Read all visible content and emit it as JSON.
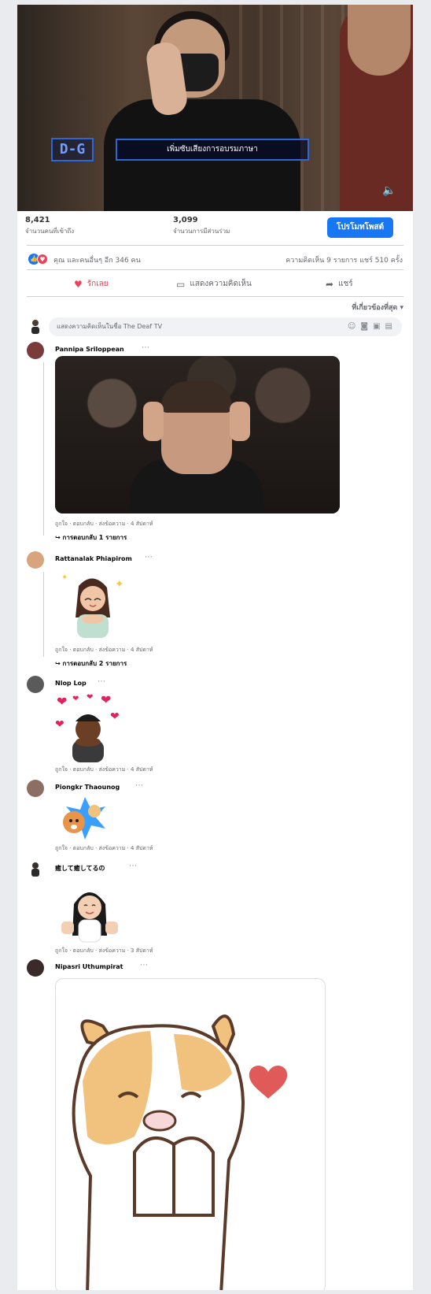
{
  "video": {
    "logo_text": "D-G",
    "caption": "เพิ่มซับเสียงการอบรมภาษา"
  },
  "stats": {
    "views_count": "8,421",
    "views_label": "จำนวนคนที่เข้าถึง",
    "engagement_count": "3,099",
    "engagement_label": "จำนวนการมีส่วนร่วม",
    "boost_button": "โปรโมทโพสต์"
  },
  "reactions": {
    "summary": "คุณ และคนอื่นๆ อีก 346 คน",
    "meta": "ความคิดเห็น 9 รายการ  แชร์ 510 ครั้ง"
  },
  "actions": {
    "love": "รักเลย",
    "comment": "แสดงความคิดเห็น",
    "share": "แชร์"
  },
  "sort_label": "ที่เกี่ยวข้องที่สุด ▾",
  "composer": {
    "placeholder": "แสดงความคิดเห็นในชื่อ The Deaf TV"
  },
  "comments": [
    {
      "name": "Pannipa Sriloppean",
      "meta": "ถูกใจ · ตอบกลับ · ส่งข้อความ · 4 สัปดาห์",
      "replies": "↪ การตอบกลับ 1 รายการ"
    },
    {
      "name": "Rattanalak Phiapirom",
      "meta": "ถูกใจ · ตอบกลับ · ส่งข้อความ · 4 สัปดาห์",
      "replies": "↪ การตอบกลับ 2 รายการ"
    },
    {
      "name": "Nlop Lop",
      "meta": "ถูกใจ · ตอบกลับ · ส่งข้อความ · 4 สัปดาห์"
    },
    {
      "name": "Piongkr Thaounog",
      "meta": "ถูกใจ · ตอบกลับ · ส่งข้อความ · 4 สัปดาห์"
    },
    {
      "name": "癒して癒してるの",
      "meta": "ถูกใจ · ตอบกลับ · ส่งข้อความ · 3 สัปดาห์"
    },
    {
      "name": "Nipasri Uthumpirat"
    }
  ],
  "colors": {
    "facebook_blue": "#1877f2",
    "love_red": "#f33e58"
  }
}
